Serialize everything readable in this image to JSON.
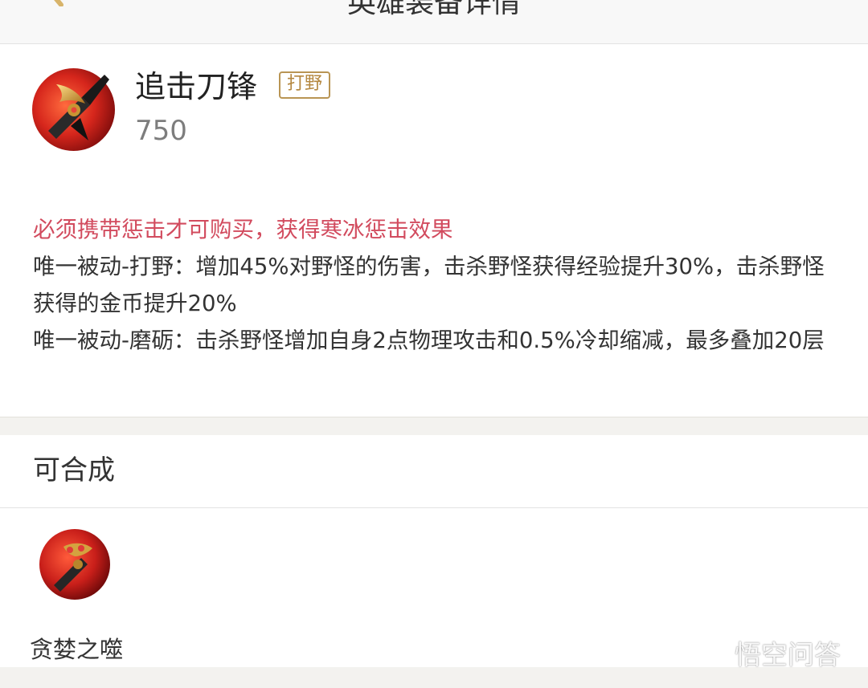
{
  "header": {
    "title": "英雄装备详情",
    "back_icon": "back-arrow-icon"
  },
  "item": {
    "icon": "chaser-blade-icon",
    "name": "追击刀锋",
    "tag": "打野",
    "price": "750",
    "requirement": "必须携带惩击才可购买，获得寒冰惩击效果",
    "passives": [
      "唯一被动-打野：增加45%对野怪的伤害，击杀野怪获得经验提升30%，击杀野怪获得的金币提升20%",
      "唯一被动-磨砺：击杀野怪增加自身2点物理攻击和0.5%冷却缩减，最多叠加20层"
    ]
  },
  "craft": {
    "section_label": "可合成",
    "items": [
      {
        "icon": "greedy-devour-icon",
        "name": "贪婪之噬"
      }
    ]
  },
  "watermark": {
    "text": "悟空问答",
    "icon": "chat-bubbles-icon"
  },
  "colors": {
    "accent_red": "#d24b5e",
    "tag_gold": "#b4873f",
    "background": "#f3f2ef"
  }
}
